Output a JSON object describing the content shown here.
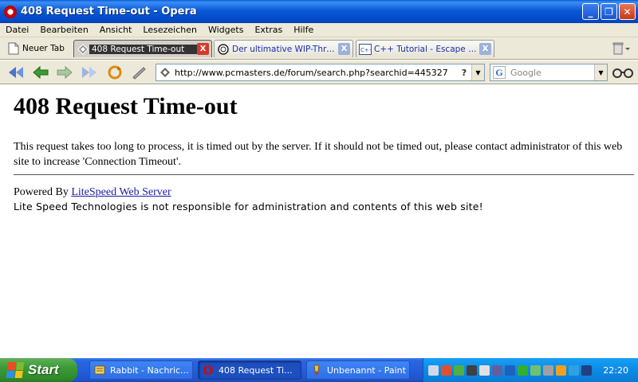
{
  "window": {
    "title": "408 Request Time-out - Opera",
    "minimize": "_",
    "restore": "❐",
    "close": "✕"
  },
  "menu": [
    "Datei",
    "Bearbeiten",
    "Ansicht",
    "Lesezeichen",
    "Widgets",
    "Extras",
    "Hilfe"
  ],
  "tabs": {
    "new_tab": "Neuer Tab",
    "items": [
      {
        "label": "408 Request Time-out",
        "active": true
      },
      {
        "label": "Der ultimative WIP-Thre...",
        "active": false
      },
      {
        "label": "C++ Tutorial - Escape S...",
        "active": false
      }
    ],
    "close_glyph": "X"
  },
  "address": {
    "url": "http://www.pcmasters.de/forum/search.php?searchid=445327",
    "help": "?"
  },
  "search": {
    "engine_icon": "G",
    "placeholder": "Google"
  },
  "page": {
    "heading": "408 Request Time-out",
    "message": "This request takes too long to process, it is timed out by the server. If it should not be timed out, please contact administrator of this web site to increase 'Connection Timeout'.",
    "powered_prefix": "Powered By ",
    "powered_link": "LiteSpeed Web Server",
    "disclaimer": "Lite Speed Technologies is not responsible for administration and contents of this web site!"
  },
  "taskbar": {
    "start": "Start",
    "items": [
      {
        "label": "Rabbit - Nachric...",
        "active": false
      },
      {
        "label": "408 Request Ti...",
        "active": true
      },
      {
        "label": "Unbenannt - Paint",
        "active": false
      }
    ],
    "clock": "22:20"
  },
  "colors": {
    "link": "#1a1aa6",
    "titlebar": "#0a59d6",
    "taskbar": "#245edb",
    "start": "#3c9a37",
    "tray": "#0e8ae3"
  }
}
